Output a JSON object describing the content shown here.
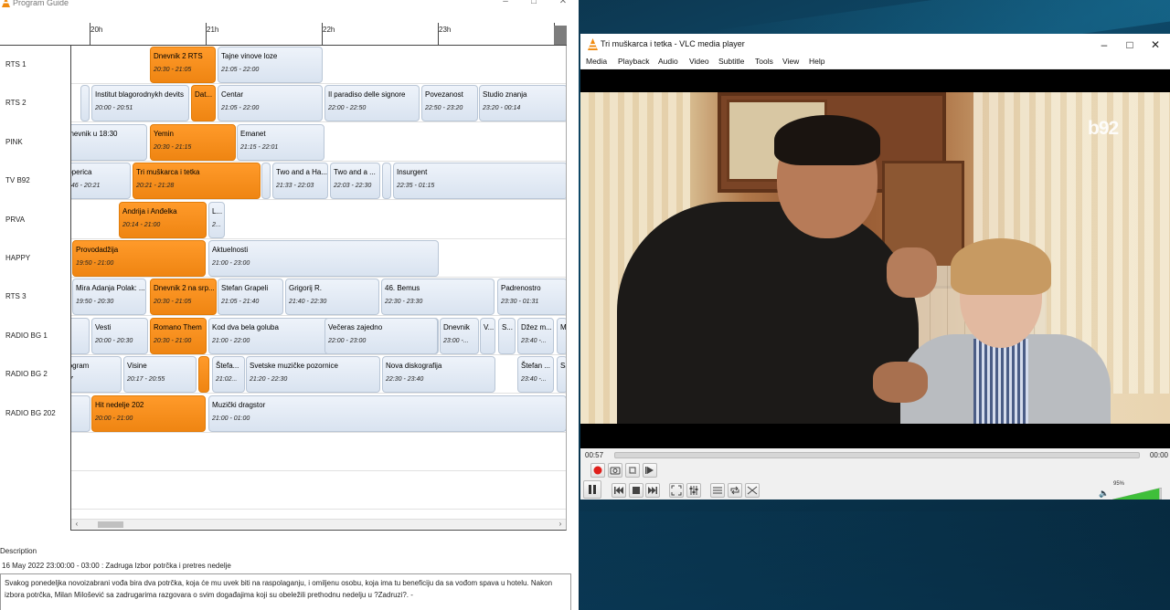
{
  "pg": {
    "title": "Program Guide",
    "hours": [
      "20h",
      "21h",
      "22h",
      "23h",
      "00h"
    ],
    "channels": [
      "RTS 1",
      "RTS 2",
      "PINK",
      "TV B92",
      "PRVA",
      "HAPPY",
      "RTS 3",
      "RADIO BG 1",
      "RADIO BG 2",
      "RADIO BG 202"
    ],
    "rows": [
      [
        {
          "name": "Dnevnik 2 RTS",
          "time": "20:30 - 21:05",
          "now": true
        },
        {
          "name": "Tajne vinove loze",
          "time": "21:05 - 22:00"
        }
      ],
      [
        {
          "name": "",
          "time": ""
        },
        {
          "name": "",
          "time": ""
        },
        {
          "name": "Institut blagorodnykh devits",
          "time": "20:00 - 20:51"
        },
        {
          "name": "Dat...",
          "time": "",
          "now": true
        },
        {
          "name": "Centar",
          "time": "21:05 - 22:00"
        },
        {
          "name": "Il paradiso delle signore",
          "time": "22:00 - 22:50"
        },
        {
          "name": "Povezanost",
          "time": "22:50 - 23:20"
        },
        {
          "name": "Studio znanja",
          "time": "23:20 - 00:14"
        }
      ],
      [
        {
          "name": "dnevnik u 18:30",
          "time": "0"
        },
        {
          "name": "Yemin",
          "time": "20:30 - 21:15",
          "now": true
        },
        {
          "name": "Emanet",
          "time": "21:15 - 22:01"
        }
      ],
      [
        {
          "name": "toperica",
          "time": "9:46 - 20:21"
        },
        {
          "name": "Tri muškarca i tetka",
          "time": "20:21 - 21:28",
          "now": true
        },
        {
          "name": "",
          "time": ""
        },
        {
          "name": "Two and a Ha...",
          "time": "21:33 - 22:03"
        },
        {
          "name": "Two and a ...",
          "time": "22:03 - 22:30"
        },
        {
          "name": "",
          "time": ""
        },
        {
          "name": "Insurgent",
          "time": "22:35 - 01:15"
        }
      ],
      [
        {
          "name": "Andrija i Anđelka",
          "time": "20:14 - 21:00",
          "now": true
        },
        {
          "name": "L...",
          "time": "2..."
        }
      ],
      [
        {
          "name": "Provodadžija",
          "time": "19:50 - 21:00",
          "now": true
        },
        {
          "name": "Aktuelnosti",
          "time": "21:00 - 23:00"
        }
      ],
      [
        {
          "name": "Mira Adanja Polak: ...",
          "time": "19:50 - 20:30"
        },
        {
          "name": "Dnevnik 2 na srp...",
          "time": "20:30 - 21:05",
          "now": true
        },
        {
          "name": "Stefan Grapeli",
          "time": "21:05 - 21:40"
        },
        {
          "name": "Grigorij R.",
          "time": "21:40 - 22:30"
        },
        {
          "name": "46. Bemus",
          "time": "22:30 - 23:30"
        },
        {
          "name": "Padrenostro",
          "time": "23:30 - 01:31"
        }
      ],
      [
        {
          "name": "",
          "time": ""
        },
        {
          "name": "Vesti",
          "time": "20:00 - 20:30"
        },
        {
          "name": "Romano Them",
          "time": "20:30 - 21:00",
          "now": true
        },
        {
          "name": "Kod dva bela goluba",
          "time": "21:00 - 22:00"
        },
        {
          "name": "Večeras zajedno",
          "time": "22:00 - 23:00"
        },
        {
          "name": "Dnevnik",
          "time": "23:00 -..."
        },
        {
          "name": "V...",
          "time": ""
        },
        {
          "name": "S...",
          "time": ""
        },
        {
          "name": "Džez m...",
          "time": "23:40 -..."
        },
        {
          "name": "Mo...",
          "time": ""
        }
      ],
      [
        {
          "name": "rogram",
          "time": "17"
        },
        {
          "name": "Visine",
          "time": "20:17 - 20:55"
        },
        {
          "name": "",
          "time": "",
          "now": true
        },
        {
          "name": "Štefa...",
          "time": "21:02..."
        },
        {
          "name": "Svetske muzičke pozornice",
          "time": "21:20 - 22:30"
        },
        {
          "name": "Nova diskografija",
          "time": "22:30 - 23:40"
        },
        {
          "name": "Štefan ...",
          "time": "23:40 -..."
        },
        {
          "name": "Sa...",
          "time": ""
        }
      ],
      [
        {
          "name": "",
          "time": ""
        },
        {
          "name": "Hit nedelje 202",
          "time": "20:00 - 21:00",
          "now": true
        },
        {
          "name": "Muzički dragstor",
          "time": "21:00 - 01:00"
        }
      ]
    ],
    "description": {
      "label": "Description",
      "heading": "16 May 2022 23:00:00 - 03:00 : Zadruga Izbor potrčka i pretres nedelje",
      "text": "Svakog ponedeljka novoizabrani vođa bira dva potrčka, koja će mu uvek biti na raspolaganju, i omiljenu osobu, koja ima tu beneficiju da sa vođom spava u hotelu. Nakon izbora potrčka, Milan Milošević sa zadrugarima razgovara o svim događajima koji su obeležili prethodnu nedelju u ?Zadruzi?. -"
    }
  },
  "vlc": {
    "title": "Tri muškarca i tetka - VLC media player",
    "menu": [
      "Media",
      "Playback",
      "Audio",
      "Video",
      "Subtitle",
      "Tools",
      "View",
      "Help"
    ],
    "time_elapsed": "00:57",
    "time_total": "00:00",
    "progress": 0.0,
    "volume_label": "95%",
    "volume": 0.95,
    "watermark": "b92",
    "accent": "#ff8800"
  }
}
